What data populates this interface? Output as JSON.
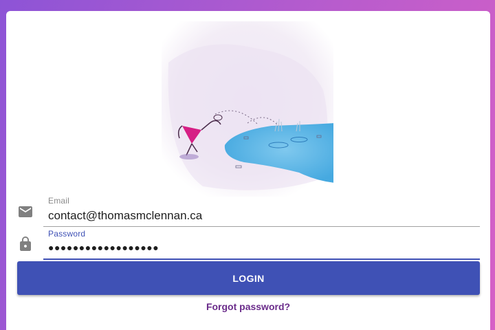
{
  "colors": {
    "background_gradient_start": "#8d54d6",
    "background_gradient_end": "#d660c6",
    "primary": "#3f51b5",
    "link": "#6a2b8a",
    "label_inactive": "#8a8a8a",
    "label_active": "#3f51b5"
  },
  "hero": {
    "image_semantic": "watercolor-illustration"
  },
  "form": {
    "email": {
      "icon": "mail-icon",
      "label": "Email",
      "value": "contact@thomasmclennan.ca"
    },
    "password": {
      "icon": "lock-icon",
      "label": "Password",
      "value": "●●●●●●●●●●●●●●●●●●"
    },
    "login_label": "LOGIN",
    "forgot_label": "Forgot password?"
  }
}
